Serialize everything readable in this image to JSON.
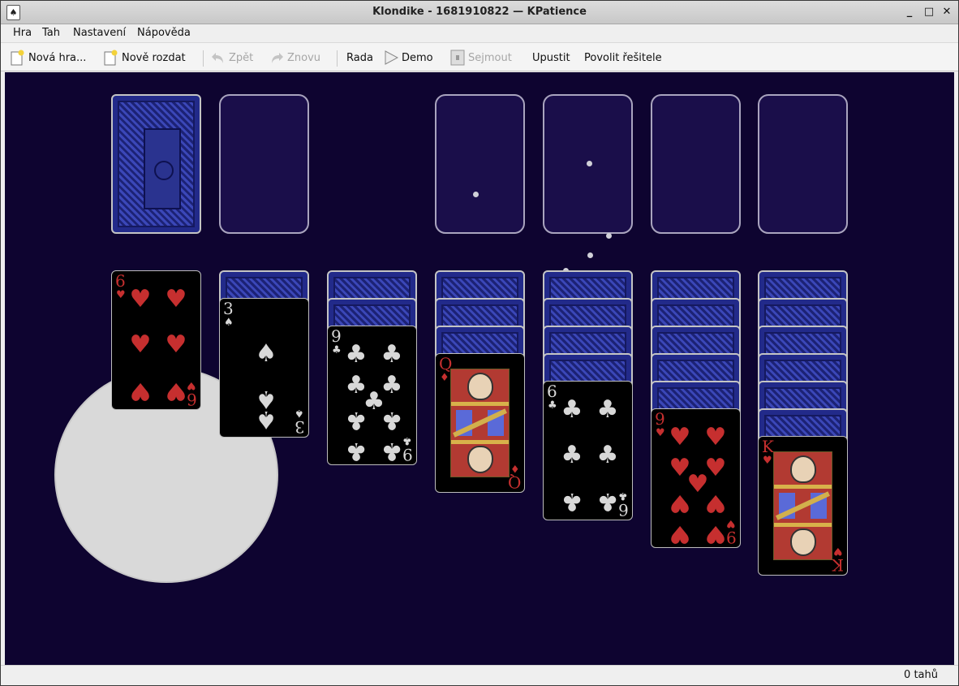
{
  "window": {
    "title": "Klondike - 1681910822 — KPatience",
    "app_icon": "♠",
    "minimize_glyph": "_",
    "maximize_glyph": "□",
    "close_glyph": "✕"
  },
  "menu": {
    "items": [
      "Hra",
      "Tah",
      "Nastavení",
      "Nápověda"
    ]
  },
  "toolbar": {
    "new_game": "Nová hra...",
    "redeal": "Nově rozdat",
    "undo": "Zpět",
    "redo": "Znovu",
    "hint": "Rada",
    "demo": "Demo",
    "drop": "Sejmout",
    "drop_all": "Upustit",
    "enable_solver": "Povolit řešitele"
  },
  "game": {
    "background_color": "#0e0430",
    "tableau": [
      {
        "hidden": 0,
        "face_up": {
          "rank": "6",
          "suit": "♥",
          "color": "red"
        }
      },
      {
        "hidden": 1,
        "face_up": {
          "rank": "3",
          "suit": "♠",
          "color": "white"
        }
      },
      {
        "hidden": 2,
        "face_up": {
          "rank": "9",
          "suit": "♣",
          "color": "white"
        }
      },
      {
        "hidden": 3,
        "face_up": {
          "rank": "Q",
          "suit": "♦",
          "color": "red"
        }
      },
      {
        "hidden": 4,
        "face_up": {
          "rank": "6",
          "suit": "♣",
          "color": "white"
        }
      },
      {
        "hidden": 5,
        "face_up": {
          "rank": "9",
          "suit": "♥",
          "color": "red"
        }
      },
      {
        "hidden": 6,
        "face_up": {
          "rank": "K",
          "suit": "♥",
          "color": "red"
        }
      }
    ]
  },
  "status": {
    "moves": "0 tahů"
  }
}
